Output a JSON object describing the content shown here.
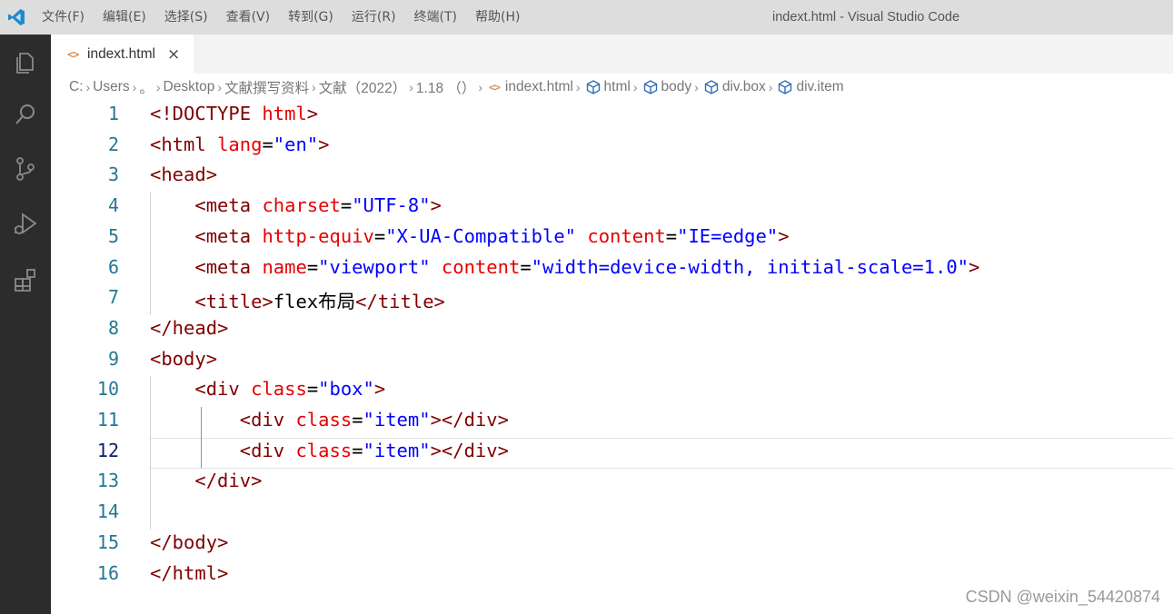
{
  "window": {
    "title": "indext.html - Visual Studio Code"
  },
  "menu": [
    "文件(F)",
    "编辑(E)",
    "选择(S)",
    "查看(V)",
    "转到(G)",
    "运行(R)",
    "终端(T)",
    "帮助(H)"
  ],
  "tab": {
    "icon_glyph": "<>",
    "label": "indext.html",
    "close_glyph": "×"
  },
  "breadcrumb": {
    "separator": "›",
    "path": [
      "C:",
      "Users",
      "。",
      "Desktop",
      "文献撰写资料",
      "文献（2022）",
      "1.18 （）"
    ],
    "file": "indext.html",
    "symbols": [
      "html",
      "body",
      "div.box",
      "div.item"
    ]
  },
  "editor": {
    "active_line": 12,
    "lines": [
      {
        "n": "1",
        "tokens": [
          [
            "tag",
            "<!DOCTYPE "
          ],
          [
            "attr",
            "html"
          ],
          [
            "tag",
            ">"
          ]
        ]
      },
      {
        "n": "2",
        "tokens": [
          [
            "tag",
            "<html "
          ],
          [
            "attr",
            "lang"
          ],
          [
            "text",
            "="
          ],
          [
            "val",
            "\"en\""
          ],
          [
            "tag",
            ">"
          ]
        ]
      },
      {
        "n": "3",
        "tokens": [
          [
            "tag",
            "<head>"
          ]
        ]
      },
      {
        "n": "4",
        "tokens": [
          [
            "text",
            "    "
          ],
          [
            "tag",
            "<meta "
          ],
          [
            "attr",
            "charset"
          ],
          [
            "text",
            "="
          ],
          [
            "val",
            "\"UTF-8\""
          ],
          [
            "tag",
            ">"
          ]
        ]
      },
      {
        "n": "5",
        "tokens": [
          [
            "text",
            "    "
          ],
          [
            "tag",
            "<meta "
          ],
          [
            "attr",
            "http-equiv"
          ],
          [
            "text",
            "="
          ],
          [
            "val",
            "\"X-UA-Compatible\""
          ],
          [
            "text",
            " "
          ],
          [
            "attr",
            "content"
          ],
          [
            "text",
            "="
          ],
          [
            "val",
            "\"IE=edge\""
          ],
          [
            "tag",
            ">"
          ]
        ]
      },
      {
        "n": "6",
        "tokens": [
          [
            "text",
            "    "
          ],
          [
            "tag",
            "<meta "
          ],
          [
            "attr",
            "name"
          ],
          [
            "text",
            "="
          ],
          [
            "val",
            "\"viewport\""
          ],
          [
            "text",
            " "
          ],
          [
            "attr",
            "content"
          ],
          [
            "text",
            "="
          ],
          [
            "val",
            "\"width=device-width, initial-scale=1.0\""
          ],
          [
            "tag",
            ">"
          ]
        ]
      },
      {
        "n": "7",
        "tokens": [
          [
            "text",
            "    "
          ],
          [
            "tag",
            "<title>"
          ],
          [
            "text",
            "flex布局"
          ],
          [
            "tag",
            "</title>"
          ]
        ]
      },
      {
        "n": "8",
        "tokens": [
          [
            "tag",
            "</head>"
          ]
        ]
      },
      {
        "n": "9",
        "tokens": [
          [
            "tag",
            "<body>"
          ]
        ]
      },
      {
        "n": "10",
        "tokens": [
          [
            "text",
            "    "
          ],
          [
            "tag",
            "<div "
          ],
          [
            "attr",
            "class"
          ],
          [
            "text",
            "="
          ],
          [
            "val",
            "\"box\""
          ],
          [
            "tag",
            ">"
          ]
        ]
      },
      {
        "n": "11",
        "tokens": [
          [
            "text",
            "        "
          ],
          [
            "tag",
            "<div "
          ],
          [
            "attr",
            "class"
          ],
          [
            "text",
            "="
          ],
          [
            "val",
            "\"item\""
          ],
          [
            "tag",
            "></div>"
          ]
        ]
      },
      {
        "n": "12",
        "tokens": [
          [
            "text",
            "        "
          ],
          [
            "tag",
            "<div "
          ],
          [
            "attr",
            "class"
          ],
          [
            "text",
            "="
          ],
          [
            "val",
            "\"item\""
          ],
          [
            "tag",
            "></div>"
          ]
        ]
      },
      {
        "n": "13",
        "tokens": [
          [
            "text",
            "    "
          ],
          [
            "tag",
            "</div>"
          ]
        ]
      },
      {
        "n": "14",
        "tokens": []
      },
      {
        "n": "15",
        "tokens": [
          [
            "tag",
            "</body>"
          ]
        ]
      },
      {
        "n": "16",
        "tokens": [
          [
            "tag",
            "</html>"
          ]
        ]
      }
    ]
  },
  "watermark": "CSDN @weixin_54420874",
  "colors": {
    "titlebar_bg": "#dddddd",
    "activitybar_bg": "#2c2c2c",
    "tag": "#800000",
    "attribute": "#e50000",
    "string": "#0000ff",
    "line_number": "#237893",
    "line_number_active": "#0b216f",
    "vscode_logo": "#1a8ad4"
  },
  "activity_icons": [
    "explorer-icon",
    "search-icon",
    "source-control-icon",
    "run-debug-icon",
    "extensions-icon"
  ]
}
